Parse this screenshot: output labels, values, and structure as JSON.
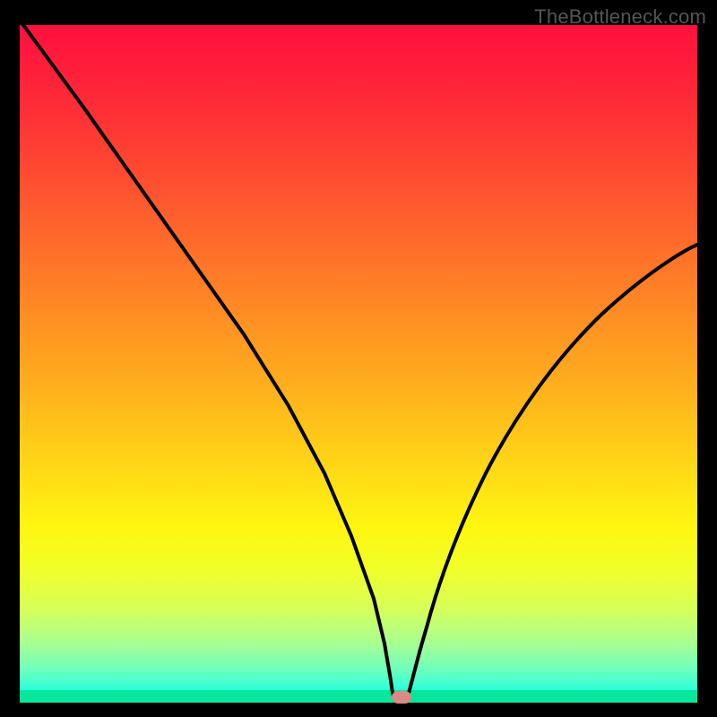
{
  "watermark": "TheBottleneck.com",
  "chart_data": {
    "type": "line",
    "title": "",
    "xlabel": "",
    "ylabel": "",
    "xlim": [
      0,
      100
    ],
    "ylim": [
      0,
      100
    ],
    "x": [
      0,
      5,
      10,
      15,
      20,
      25,
      30,
      35,
      40,
      45,
      50,
      52,
      54,
      55,
      56,
      58,
      60,
      65,
      70,
      75,
      80,
      85,
      90,
      95,
      100
    ],
    "values": [
      100,
      91,
      82,
      73,
      64,
      55,
      46,
      37,
      28,
      19,
      9,
      5,
      1,
      0,
      0.5,
      3,
      8,
      19,
      29,
      37,
      44,
      50,
      55,
      59,
      62
    ],
    "marker": {
      "x": 55,
      "y": 0
    },
    "colors": {
      "gradient_top": "#ff103e",
      "gradient_bottom": "#00ffcf",
      "line": "#000000",
      "marker": "#d88b84",
      "frame": "#000000"
    }
  }
}
